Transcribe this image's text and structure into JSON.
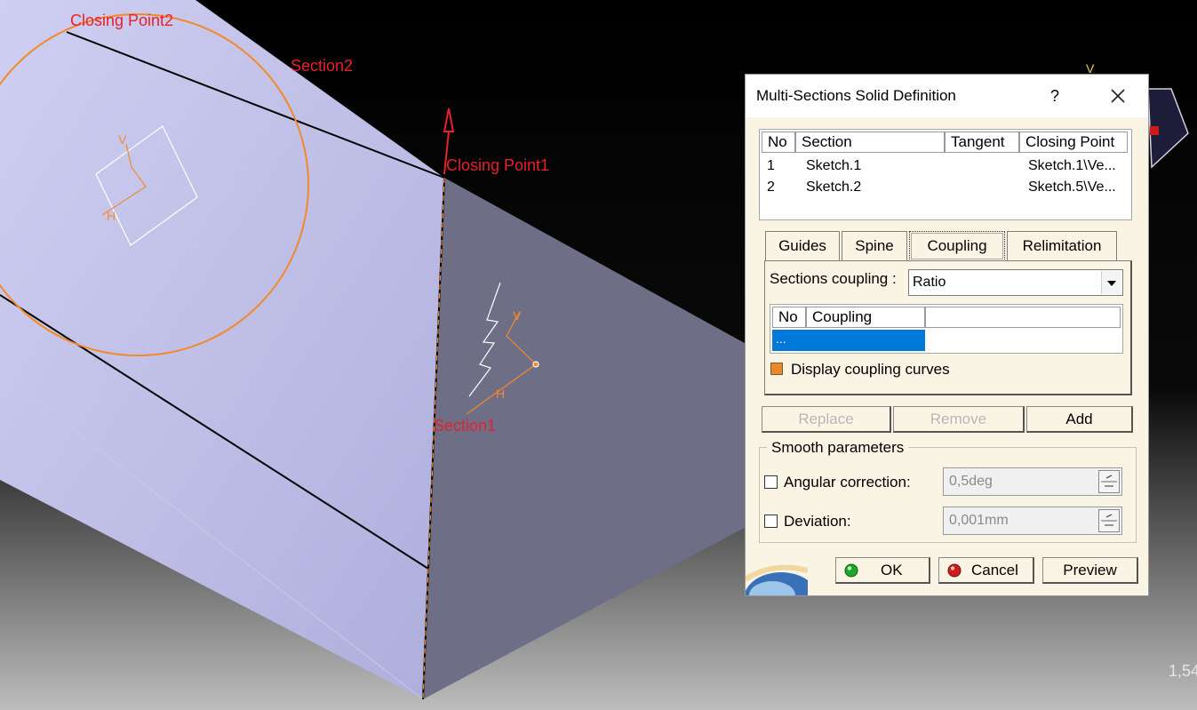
{
  "viewport": {
    "labels": {
      "closing_point_2": "Closing Point2",
      "section_2": "Section2",
      "closing_point_1": "Closing Point1",
      "section_1": "Section1"
    },
    "axis_letters": {
      "v": "V",
      "h": "H"
    },
    "zoom_readout": "1,54"
  },
  "colors": {
    "body_light": "#c4c4ea",
    "body_dark": "#6e6e86",
    "label_red": "#e8202a",
    "orange": "#f28a2a",
    "selection_blue": "#0078d7"
  },
  "dialog": {
    "title": "Multi-Sections Solid Definition",
    "help": "?",
    "sections_table": {
      "headers": [
        "No",
        "Section",
        "Tangent",
        "Closing Point"
      ],
      "rows": [
        {
          "no": "1",
          "section": "Sketch.1",
          "tangent": "",
          "closing_point": "Sketch.1\\Ve..."
        },
        {
          "no": "2",
          "section": "Sketch.2",
          "tangent": "",
          "closing_point": "Sketch.5\\Ve..."
        }
      ]
    },
    "tabs": [
      {
        "label": "Guides",
        "active": false
      },
      {
        "label": "Spine",
        "active": false
      },
      {
        "label": "Coupling",
        "active": true
      },
      {
        "label": "Relimitation",
        "active": false
      }
    ],
    "coupling": {
      "label": "Sections coupling :",
      "selected": "Ratio",
      "table_headers": [
        "No",
        "Coupling"
      ],
      "selected_row": "...",
      "display_checkbox_label": "Display coupling curves"
    },
    "buttons": {
      "replace": "Replace",
      "remove": "Remove",
      "add": "Add"
    },
    "smooth": {
      "legend": "Smooth parameters",
      "angular_label": "Angular correction:",
      "angular_value": "0,5deg",
      "deviation_label": "Deviation:",
      "deviation_value": "0,001mm"
    },
    "footer": {
      "ok": "OK",
      "cancel": "Cancel",
      "preview": "Preview"
    }
  }
}
